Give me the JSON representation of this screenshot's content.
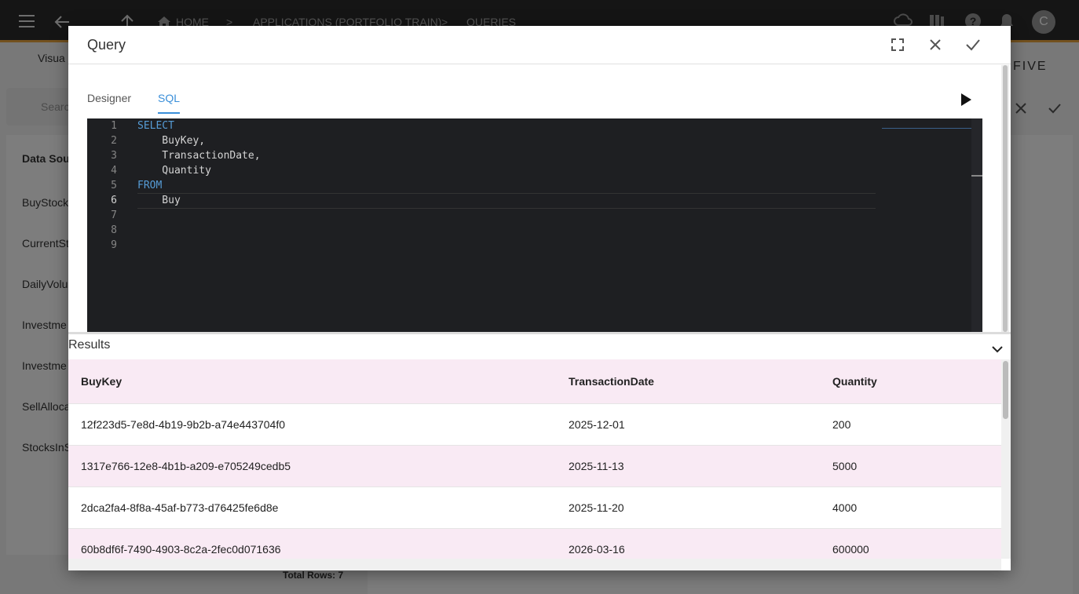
{
  "topbar": {
    "breadcrumb": [
      "HOME",
      "APPLICATIONS (PORTFOLIO TRAIN)",
      "QUERIES"
    ],
    "avatar": "C",
    "brand": "FIVE"
  },
  "background": {
    "visual_label": "Visua",
    "search_placeholder": "Searc",
    "tab_label": "Data Sou",
    "items": [
      "BuyStock",
      "CurrentSt",
      "DailyVolu",
      "Investme",
      "Investme",
      "SellAlloca",
      "StocksInS"
    ],
    "total_rows": "Total Rows: 7"
  },
  "dialog": {
    "title": "Query",
    "tabs": [
      {
        "label": "Designer",
        "active": false
      },
      {
        "label": "SQL",
        "active": true
      }
    ],
    "editor": {
      "line_numbers": [
        "1",
        "2",
        "3",
        "4",
        "5",
        "6",
        "7",
        "8",
        "9"
      ],
      "lines": [
        "SELECT",
        "    BuyKey,",
        "    TransactionDate,",
        "    Quantity",
        "FROM",
        "    Buy",
        "",
        "",
        ""
      ],
      "current_line": 6
    },
    "results": {
      "title": "Results",
      "columns": [
        "BuyKey",
        "TransactionDate",
        "Quantity"
      ],
      "rows": [
        [
          "12f223d5-7e8d-4b19-9b2b-a74e443704f0",
          "2025-12-01",
          "200"
        ],
        [
          "1317e766-12e8-4b1b-a209-e705249cedb5",
          "2025-11-13",
          "5000"
        ],
        [
          "2dca2fa4-8f8a-45af-b773-d76425fe6d8e",
          "2025-11-20",
          "4000"
        ],
        [
          "60b8df6f-7490-4903-8c2a-2fec0d071636",
          "2026-03-16",
          "600000"
        ]
      ]
    }
  },
  "colors": {
    "accent": "#3a8fd9",
    "row_alt": "#f9eaf4",
    "editor_bg": "#1e1f22",
    "keyword": "#569cd6"
  }
}
